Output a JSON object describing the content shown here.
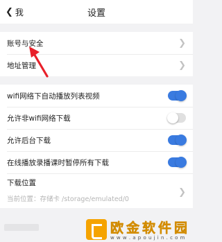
{
  "header": {
    "back_label": "我",
    "title": "设置"
  },
  "account_group": [
    {
      "label": "账号与安全"
    },
    {
      "label": "地址管理"
    }
  ],
  "download_group": {
    "toggles": [
      {
        "label": "wifi网络下自动播放列表视频",
        "state": "on"
      },
      {
        "label": "允许非wifi网络下载",
        "state": "off"
      },
      {
        "label": "允许后台下载",
        "state": "on"
      },
      {
        "label": "在线播放录播课时暂停所有下载",
        "state": "on"
      }
    ],
    "location": {
      "label": "下载位置",
      "path": "当前位置：存储卡 /storage/emulated/0"
    }
  },
  "colors": {
    "accent": "#3a7be0",
    "annotation": "#e8202a",
    "watermark": "#f5a300"
  },
  "watermark": {
    "text": "欧金软件园",
    "url": "w w w . a p o u j i n . c o m"
  }
}
